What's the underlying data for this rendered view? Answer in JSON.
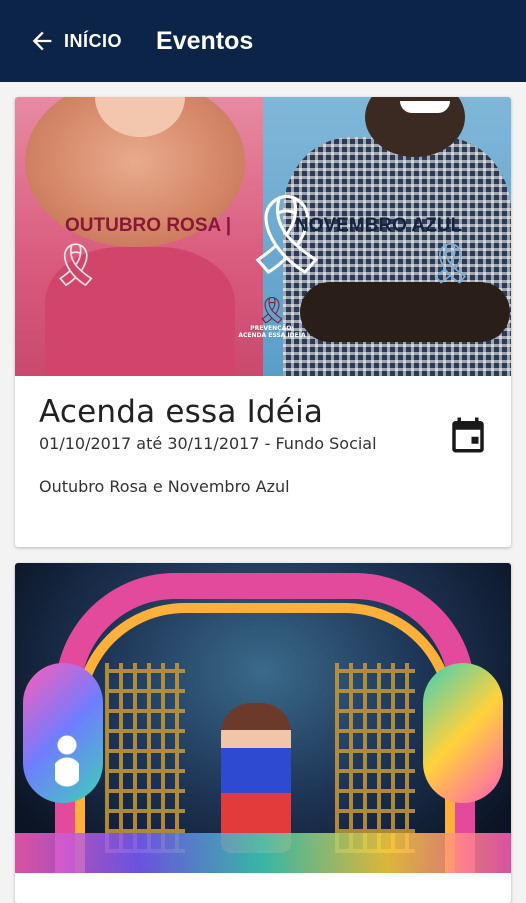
{
  "appbar": {
    "back_label": "INÍCIO",
    "title": "Eventos",
    "background": "#0b2447"
  },
  "events": [
    {
      "banner": {
        "left_text": "OUTUBRO ROSA |",
        "right_text": "NOVEMBRO AZUL",
        "logo_text_line1": "PREVENÇÃO:",
        "logo_text_line2": "ACENDA ESSA IDEIA"
      },
      "title": "Acenda essa Idéia",
      "meta": "01/10/2017 até 30/11/2017 - Fundo Social",
      "description": "Outubro Rosa e Novembro Azul",
      "icon": "calendar-icon"
    },
    {
      "image": "theater-stage-performer",
      "title": "",
      "meta": "",
      "description": ""
    }
  ]
}
